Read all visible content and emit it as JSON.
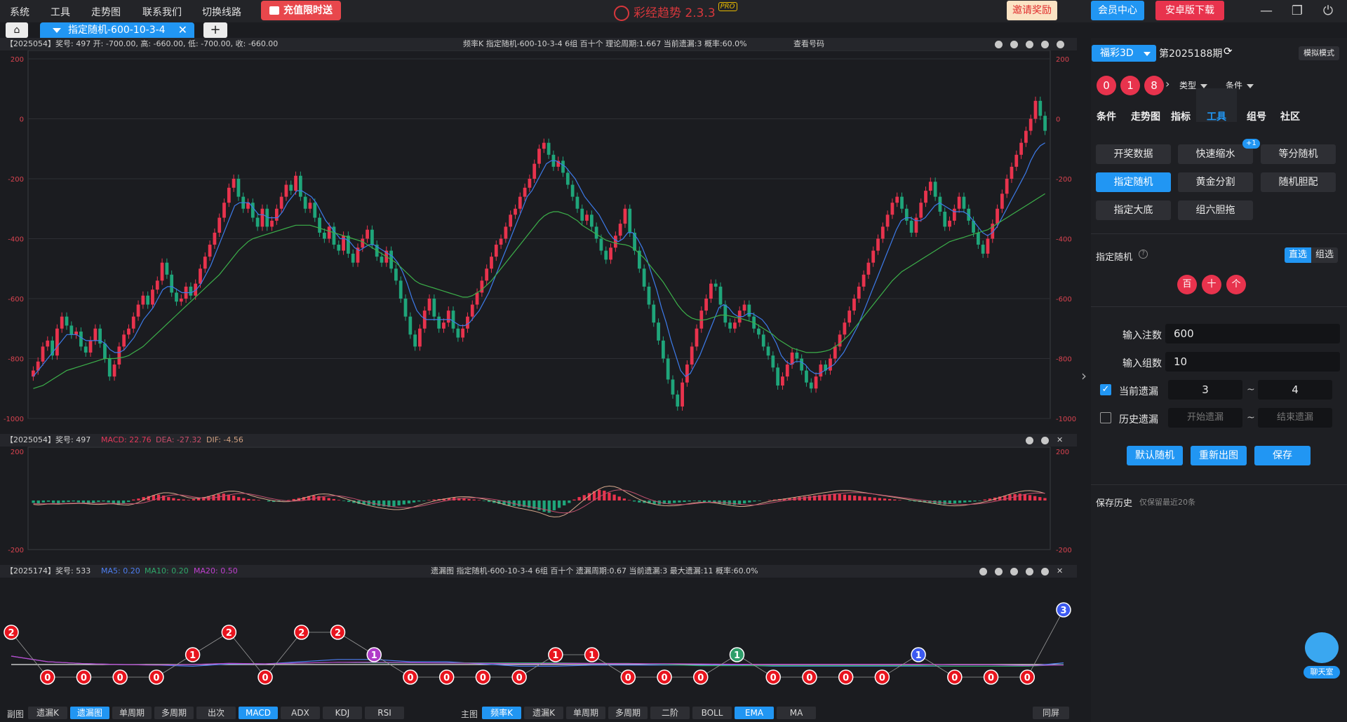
{
  "menu": [
    "系统",
    "工具",
    "走势图",
    "联系我们",
    "切换线路"
  ],
  "recharge_label": "充值限时送",
  "app_title": "彩经趋势 2.3.3",
  "app_badge": "PRO",
  "top_buttons": {
    "invite": "邀请奖励",
    "member": "会员中心",
    "android": "安卓版下载"
  },
  "tab": {
    "label": "指定随机-600-10-3-4",
    "add": "+"
  },
  "kline_head": {
    "left": "【2025054】奖号: 497  开: -700.00, 高: -660.00, 低: -700.00, 收: -660.00",
    "center": "频率K  指定随机-600-10-3-4  6组  百十个  理论周期:1.667  当前遗漏:3  概率:60.0%",
    "lookup": "查看号码"
  },
  "macd_head": {
    "prefix": "【2025054】奖号: 497",
    "macd": "MACD: 22.76",
    "dea": "DEA: -27.32",
    "dif": "DIF: -4.56"
  },
  "miss_head": {
    "prefix": "【2025174】奖号: 533",
    "ma5": "MA5: 0.20",
    "ma10": "MA10: 0.20",
    "ma20": "MA20: 0.50",
    "center": "遗漏图  指定随机-600-10-3-4  6组  百十个  遗漏周期:0.67  当前遗漏:3  最大遗漏:11  概率:60.0%"
  },
  "kline_axis": [
    "200",
    "0",
    "-200",
    "-400",
    "-600",
    "-800",
    "-1000"
  ],
  "macd_axis": [
    "200",
    "-200"
  ],
  "chart_data": [
    {
      "type": "candlestick",
      "title": "频率K",
      "ylim": [
        -1000,
        200
      ],
      "yticks": [
        200,
        0,
        -200,
        -400,
        -600,
        -800,
        -1000
      ],
      "closes": [
        -840,
        -810,
        -760,
        -740,
        -790,
        -700,
        -660,
        -690,
        -720,
        -710,
        -760,
        -780,
        -740,
        -700,
        -750,
        -800,
        -860,
        -820,
        -760,
        -720,
        -700,
        -660,
        -620,
        -590,
        -620,
        -570,
        -540,
        -480,
        -520,
        -580,
        -610,
        -600,
        -560,
        -590,
        -550,
        -500,
        -460,
        -420,
        -380,
        -330,
        -280,
        -230,
        -200,
        -260,
        -300,
        -280,
        -330,
        -360,
        -300,
        -360,
        -340,
        -300,
        -260,
        -220,
        -240,
        -190,
        -260,
        -300,
        -280,
        -330,
        -380,
        -400,
        -360,
        -420,
        -440,
        -390,
        -450,
        -480,
        -430,
        -400,
        -370,
        -420,
        -460,
        -480,
        -440,
        -500,
        -540,
        -600,
        -660,
        -720,
        -760,
        -700,
        -640,
        -600,
        -660,
        -700,
        -680,
        -640,
        -700,
        -730,
        -700,
        -660,
        -620,
        -580,
        -540,
        -500,
        -460,
        -420,
        -400,
        -360,
        -320,
        -300,
        -260,
        -230,
        -200,
        -150,
        -100,
        -80,
        -120,
        -160,
        -140,
        -180,
        -220,
        -260,
        -300,
        -340,
        -320,
        -360,
        -400,
        -440,
        -470,
        -430,
        -390,
        -350,
        -300,
        -380,
        -440,
        -500,
        -560,
        -620,
        -680,
        -740,
        -800,
        -870,
        -920,
        -960,
        -880,
        -820,
        -760,
        -700,
        -640,
        -600,
        -550,
        -560,
        -620,
        -680,
        -700,
        -680,
        -640,
        -620,
        -660,
        -700,
        -720,
        -760,
        -790,
        -830,
        -890,
        -860,
        -820,
        -780,
        -800,
        -840,
        -880,
        -900,
        -860,
        -820,
        -840,
        -800,
        -760,
        -720,
        -680,
        -640,
        -600,
        -560,
        -520,
        -480,
        -440,
        -400,
        -360,
        -320,
        -280,
        -260,
        -300,
        -340,
        -380,
        -330,
        -280,
        -240,
        -210,
        -260,
        -310,
        -360,
        -340,
        -300,
        -260,
        -300,
        -340,
        -380,
        -420,
        -450,
        -400,
        -350,
        -300,
        -250,
        -200,
        -160,
        -120,
        -80,
        -40,
        0,
        60,
        10,
        -40
      ],
      "ma_fast": [
        -860,
        -840,
        -820,
        -800,
        -780,
        -760,
        -740,
        -720,
        -720,
        -720,
        -730,
        -740,
        -740,
        -740,
        -740,
        -750,
        -770,
        -780,
        -780,
        -770,
        -750,
        -730,
        -700,
        -670,
        -650,
        -630,
        -600,
        -570,
        -560,
        -560,
        -570,
        -580,
        -580,
        -580,
        -570,
        -550,
        -520,
        -490,
        -450,
        -410,
        -370,
        -330,
        -290,
        -280,
        -280,
        -280,
        -300,
        -320,
        -320,
        -330,
        -330,
        -330,
        -310,
        -280,
        -260,
        -240,
        -240,
        -250,
        -260,
        -280,
        -310,
        -340,
        -360,
        -380,
        -400,
        -400,
        -410,
        -430,
        -440,
        -430,
        -420,
        -420,
        -430,
        -440,
        -450,
        -460,
        -480,
        -510,
        -550,
        -600,
        -640,
        -660,
        -670,
        -670,
        -670,
        -670,
        -670,
        -670,
        -680,
        -690,
        -690,
        -680,
        -660,
        -640,
        -610,
        -580,
        -540,
        -500,
        -460,
        -420,
        -380,
        -340,
        -300,
        -260,
        -240,
        -210,
        -180,
        -150,
        -140,
        -140,
        -150,
        -160,
        -180,
        -200,
        -230,
        -260,
        -280,
        -300,
        -320,
        -350,
        -380,
        -400,
        -410,
        -400,
        -380,
        -380,
        -400,
        -430,
        -470,
        -520,
        -570,
        -630,
        -680,
        -740,
        -790,
        -840,
        -860,
        -850,
        -820,
        -790,
        -750,
        -710,
        -670,
        -630,
        -620,
        -630,
        -650,
        -660,
        -660,
        -650,
        -650,
        -660,
        -670,
        -690,
        -720,
        -750,
        -790,
        -810,
        -820,
        -810,
        -810,
        -820,
        -840,
        -850,
        -850,
        -840,
        -830,
        -820,
        -800,
        -780,
        -750,
        -720,
        -690,
        -650,
        -610,
        -570,
        -530,
        -490,
        -450,
        -410,
        -370,
        -340,
        -330,
        -330,
        -340,
        -340,
        -330,
        -310,
        -290,
        -280,
        -290,
        -300,
        -310,
        -310,
        -310,
        -320,
        -340,
        -360,
        -380,
        -390,
        -380,
        -360,
        -330,
        -300,
        -270,
        -240,
        -210,
        -180,
        -140,
        -110,
        -90,
        -80
      ],
      "ma_slow": [
        -900,
        -895,
        -890,
        -880,
        -870,
        -860,
        -850,
        -840,
        -835,
        -830,
        -825,
        -820,
        -815,
        -810,
        -805,
        -800,
        -800,
        -800,
        -798,
        -795,
        -790,
        -780,
        -770,
        -760,
        -745,
        -730,
        -715,
        -700,
        -685,
        -670,
        -655,
        -640,
        -625,
        -610,
        -595,
        -580,
        -565,
        -550,
        -535,
        -520,
        -500,
        -480,
        -460,
        -440,
        -425,
        -410,
        -400,
        -395,
        -390,
        -385,
        -380,
        -375,
        -370,
        -365,
        -360,
        -355,
        -355,
        -355,
        -355,
        -360,
        -365,
        -370,
        -375,
        -380,
        -385,
        -390,
        -395,
        -400,
        -405,
        -410,
        -420,
        -430,
        -440,
        -450,
        -460,
        -470,
        -480,
        -495,
        -510,
        -525,
        -540,
        -550,
        -555,
        -560,
        -565,
        -570,
        -575,
        -580,
        -585,
        -590,
        -595,
        -595,
        -590,
        -580,
        -570,
        -555,
        -540,
        -520,
        -500,
        -480,
        -460,
        -440,
        -420,
        -400,
        -380,
        -360,
        -340,
        -325,
        -315,
        -310,
        -310,
        -315,
        -320,
        -330,
        -340,
        -355,
        -365,
        -375,
        -385,
        -395,
        -405,
        -410,
        -415,
        -418,
        -420,
        -425,
        -435,
        -450,
        -465,
        -485,
        -505,
        -525,
        -545,
        -570,
        -595,
        -620,
        -640,
        -655,
        -665,
        -670,
        -672,
        -670,
        -665,
        -660,
        -655,
        -655,
        -658,
        -662,
        -665,
        -670,
        -675,
        -680,
        -690,
        -700,
        -710,
        -720,
        -735,
        -745,
        -755,
        -765,
        -770,
        -775,
        -780,
        -780,
        -780,
        -778,
        -775,
        -770,
        -760,
        -750,
        -735,
        -720,
        -700,
        -680,
        -660,
        -640,
        -620,
        -600,
        -580,
        -560,
        -540,
        -525,
        -510,
        -500,
        -490,
        -480,
        -470,
        -460,
        -450,
        -440,
        -430,
        -420,
        -410,
        -405,
        -400,
        -395,
        -390,
        -385,
        -380,
        -375,
        -370,
        -360,
        -350,
        -340,
        -330,
        -320,
        -310,
        -300,
        -290,
        -280,
        -270,
        -260,
        -250
      ],
      "series": [
        {
          "name": "MA5"
        },
        {
          "name": "MA10"
        }
      ]
    },
    {
      "type": "bar",
      "title": "MACD",
      "ylim": [
        -200,
        200
      ],
      "yticks": [
        200,
        -200
      ],
      "values": [
        -10,
        -12,
        -8,
        -5,
        -10,
        -12,
        -8,
        -6,
        -4,
        -8,
        -12,
        -14,
        -10,
        -6,
        -4,
        -8,
        -14,
        -18,
        -12,
        -6,
        4,
        8,
        14,
        18,
        22,
        24,
        20,
        14,
        10,
        6,
        4,
        2,
        6,
        10,
        14,
        18,
        22,
        26,
        28,
        24,
        20,
        14,
        10,
        6,
        4,
        2,
        0,
        -4,
        -6,
        -4,
        -2,
        2,
        6,
        10,
        14,
        18,
        20,
        18,
        14,
        10,
        6,
        2,
        -2,
        -6,
        -10,
        -14,
        -16,
        -18,
        -20,
        -22,
        -24,
        -26,
        -24,
        -20,
        -16,
        -12,
        -8,
        -4,
        -2,
        2,
        4,
        6,
        8,
        10,
        12,
        10,
        8,
        6,
        4,
        2,
        -2,
        -6,
        -10,
        -14,
        -18,
        -20,
        -22,
        -24,
        -26,
        -30,
        -34,
        -40,
        -46,
        -50,
        -40,
        -30,
        -20,
        -10,
        4,
        14,
        22,
        30,
        38,
        44,
        40,
        32,
        24,
        16,
        8,
        2,
        -4,
        -8,
        -10,
        -12,
        -14,
        -16,
        -14,
        -12,
        -10,
        -8,
        -6,
        -4,
        -2,
        -4,
        -6,
        -8,
        -10,
        -12,
        -14,
        -16,
        -18,
        -16,
        -12,
        -8,
        -4,
        -2,
        0,
        2,
        4,
        6,
        8,
        10,
        12,
        14,
        16,
        18,
        20,
        22,
        24,
        26,
        28,
        26,
        24,
        22,
        20,
        18,
        16,
        14,
        12,
        10,
        8,
        6,
        4,
        2,
        0,
        -2,
        -4,
        -6,
        -8,
        -10,
        -12,
        -14,
        -16,
        -14,
        -12,
        -10,
        -8,
        -6,
        -4,
        -2,
        4,
        8,
        12,
        16,
        20,
        24,
        26,
        28,
        26,
        22,
        18,
        14,
        10
      ],
      "series": [
        {
          "name": "MACD"
        },
        {
          "name": "DEA"
        },
        {
          "name": "DIF"
        }
      ]
    },
    {
      "type": "line",
      "title": "遗漏图",
      "values": [
        2,
        0,
        0,
        0,
        0,
        1,
        2,
        0,
        2,
        2,
        1,
        0,
        0,
        0,
        0,
        1,
        1,
        0,
        0,
        0,
        1,
        0,
        0,
        0,
        0,
        1,
        0,
        0,
        0,
        3
      ],
      "series": [
        {
          "name": "MA5"
        },
        {
          "name": "MA10"
        },
        {
          "name": "MA20"
        }
      ]
    }
  ],
  "bottom_left_label": "副图",
  "bottom_left": [
    "遗漏K",
    "遗漏图",
    "单周期",
    "多周期",
    "出次",
    "MACD",
    "ADX",
    "KDJ",
    "RSI"
  ],
  "bottom_main_label": "主图",
  "bottom_main": [
    "频率K",
    "遗漏K",
    "单周期",
    "多周期",
    "二阶",
    "BOLL",
    "EMA",
    "MA"
  ],
  "same_screen": "同屏",
  "right": {
    "lottery": "福彩3D",
    "issue": "第2025188期",
    "mode": "模拟模式",
    "balls": [
      "0",
      "1",
      "8"
    ],
    "type_dd": "类型",
    "cond_dd": "条件",
    "tabs": [
      "条件",
      "走势图",
      "指标",
      "工具",
      "组号",
      "社区"
    ],
    "tools": [
      "开奖数据",
      "快速缩水",
      "等分随机",
      "指定随机",
      "黄金分割",
      "随机胆配",
      "指定大底",
      "组六胆拖"
    ],
    "badge": "+1",
    "section_title": "指定随机",
    "mode_direct": "直选",
    "mode_group": "组选",
    "positions": [
      "百",
      "十",
      "个"
    ],
    "bets_label": "输入注数",
    "bets_value": "600",
    "groups_label": "输入组数",
    "groups_value": "10",
    "current_miss_label": "当前遗漏",
    "current_miss_from": "3",
    "current_miss_to": "4",
    "history_miss_label": "历史遗漏",
    "history_start_ph": "开始遗漏",
    "history_end_ph": "结束遗漏",
    "tilde": "~",
    "btn_default": "默认随机",
    "btn_redraw": "重新出图",
    "btn_save": "保存",
    "history_title": "保存历史",
    "history_note": "仅保留最近20条"
  },
  "chat_label": "聊天室"
}
